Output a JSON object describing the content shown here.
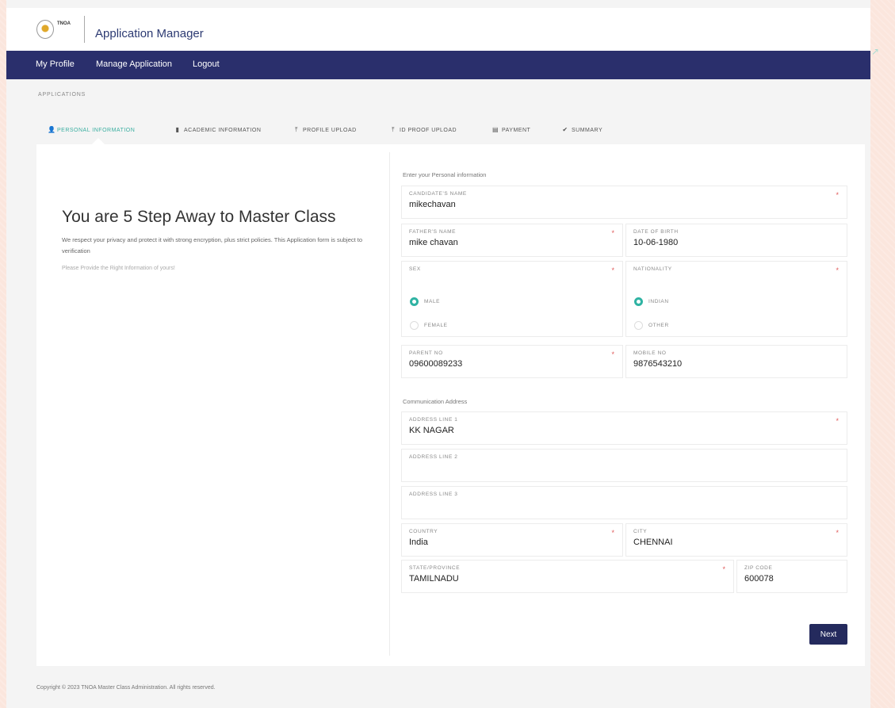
{
  "header": {
    "logo_text": "TNOA",
    "app_title": "Application Manager"
  },
  "nav": {
    "items": [
      "My Profile",
      "Manage Application",
      "Logout"
    ]
  },
  "breadcrumb": "APPLICATIONS",
  "tabs": [
    {
      "label": "PERSONAL INFORMATION",
      "icon": "user-icon",
      "glyph": "👤",
      "active": true
    },
    {
      "label": "ACADEMIC INFORMATION",
      "icon": "file-icon",
      "glyph": "▮",
      "active": false
    },
    {
      "label": "PROFILE UPLOAD",
      "icon": "upload-icon",
      "glyph": "⤒",
      "active": false
    },
    {
      "label": "ID PROOF UPLOAD",
      "icon": "upload-icon",
      "glyph": "⤒",
      "active": false
    },
    {
      "label": "PAYMENT",
      "icon": "card-icon",
      "glyph": "▤",
      "active": false
    },
    {
      "label": "SUMMARY",
      "icon": "check-icon",
      "glyph": "✔",
      "active": false
    }
  ],
  "left": {
    "heading": "You are 5 Step Away to Master Class",
    "paragraph": "We respect your privacy and protect it with strong encryption, plus strict policies. This Application form is subject to verification",
    "note": "Please Provide the Right Information of yours!"
  },
  "form": {
    "section_personal": "Enter your Personal information",
    "candidate_name": {
      "label": "CANDIDATE'S NAME",
      "value": "mikechavan"
    },
    "father_name": {
      "label": "FATHER'S NAME",
      "value": "mike chavan"
    },
    "dob": {
      "label": "DATE OF BIRTH",
      "value": "10-06-1980"
    },
    "sex": {
      "label": "SEX",
      "options": [
        "MALE",
        "FEMALE"
      ],
      "selected": "MALE"
    },
    "nationality": {
      "label": "NATIONALITY",
      "options": [
        "INDIAN",
        "OTHER"
      ],
      "selected": "INDIAN"
    },
    "parent_no": {
      "label": "PARENT NO",
      "value": "09600089233"
    },
    "mobile_no": {
      "label": "MOBILE NO",
      "value": "9876543210"
    },
    "section_address": "Communication Address",
    "address1": {
      "label": "ADDRESS LINE 1",
      "value": "KK NAGAR"
    },
    "address2": {
      "label": "ADDRESS LINE 2",
      "value": ""
    },
    "address3": {
      "label": "ADDRESS LINE 3",
      "value": ""
    },
    "country": {
      "label": "COUNTRY",
      "value": "India"
    },
    "city": {
      "label": "CITY",
      "value": "CHENNAI"
    },
    "state": {
      "label": "STATE/PROVINCE",
      "value": "TAMILNADU"
    },
    "zip": {
      "label": "ZIP CODE",
      "value": "600078"
    },
    "required_mark": "*",
    "next_label": "Next"
  },
  "footer": "Copyright © 2023 TNOA Master Class Administration. All rights reserved.",
  "colors": {
    "navbar": "#2a2f6c",
    "accent": "#2fb3a3",
    "button": "#242a5d",
    "required": "#e05a5a"
  }
}
